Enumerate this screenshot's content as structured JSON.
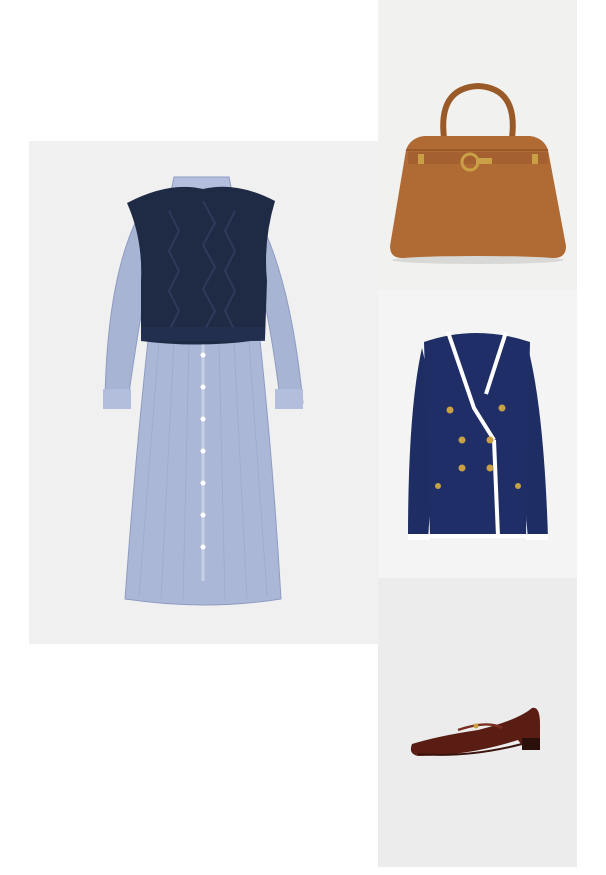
{
  "collage": {
    "items": [
      {
        "product": "shirt-dress-with-knit-vest",
        "colors": {
          "dress": "#a9b6d6",
          "vest": "#1f2a45"
        }
      },
      {
        "product": "leather-tote-bag",
        "colors": {
          "leather": "#b06a33"
        }
      },
      {
        "product": "double-breasted-blazer",
        "colors": {
          "body": "#1e2d63",
          "trim": "#ffffff",
          "buttons": "#c9a046"
        }
      },
      {
        "product": "mary-jane-flat",
        "colors": {
          "leather": "#5c1e14"
        }
      }
    ]
  }
}
